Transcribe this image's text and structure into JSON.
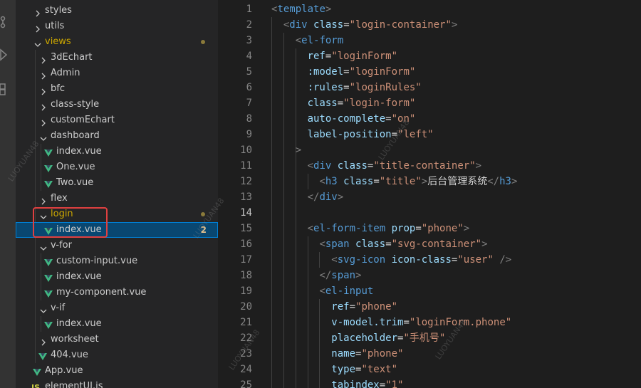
{
  "colors": {
    "selected_row": "#094771",
    "modified_label": "#cca700",
    "vue_green": "#41b883",
    "highlight_box": "#e04040"
  },
  "activity_bar": {
    "icons": [
      "source-control-icon",
      "run-debug-icon",
      "extensions-icon"
    ]
  },
  "explorer": {
    "items": [
      {
        "name": "styles",
        "type": "folder",
        "expanded": false,
        "depth": 1
      },
      {
        "name": "utils",
        "type": "folder",
        "expanded": false,
        "depth": 1
      },
      {
        "name": "views",
        "type": "folder",
        "expanded": true,
        "depth": 1,
        "modified": true
      },
      {
        "name": "3dEchart",
        "type": "folder",
        "expanded": false,
        "depth": 2
      },
      {
        "name": "Admin",
        "type": "folder",
        "expanded": false,
        "depth": 2
      },
      {
        "name": "bfc",
        "type": "folder",
        "expanded": false,
        "depth": 2
      },
      {
        "name": "class-style",
        "type": "folder",
        "expanded": false,
        "depth": 2
      },
      {
        "name": "customEchart",
        "type": "folder",
        "expanded": false,
        "depth": 2
      },
      {
        "name": "dashboard",
        "type": "folder",
        "expanded": true,
        "depth": 2
      },
      {
        "name": "index.vue",
        "type": "vue",
        "depth": 3
      },
      {
        "name": "One.vue",
        "type": "vue",
        "depth": 3
      },
      {
        "name": "Two.vue",
        "type": "vue",
        "depth": 3
      },
      {
        "name": "flex",
        "type": "folder",
        "expanded": false,
        "depth": 2
      },
      {
        "name": "login",
        "type": "folder",
        "expanded": true,
        "depth": 2,
        "modified": true
      },
      {
        "name": "index.vue",
        "type": "vue",
        "depth": 3,
        "selected": true,
        "badge": "2"
      },
      {
        "name": "v-for",
        "type": "folder",
        "expanded": true,
        "depth": 2
      },
      {
        "name": "custom-input.vue",
        "type": "vue",
        "depth": 3
      },
      {
        "name": "index.vue",
        "type": "vue",
        "depth": 3
      },
      {
        "name": "my-component.vue",
        "type": "vue",
        "depth": 3
      },
      {
        "name": "v-if",
        "type": "folder",
        "expanded": true,
        "depth": 2
      },
      {
        "name": "index.vue",
        "type": "vue",
        "depth": 3
      },
      {
        "name": "worksheet",
        "type": "folder",
        "expanded": false,
        "depth": 2
      },
      {
        "name": "404.vue",
        "type": "vue",
        "depth": 2
      },
      {
        "name": "App.vue",
        "type": "vue",
        "depth": 1
      },
      {
        "name": "elementUI.js",
        "type": "js",
        "depth": 1
      }
    ]
  },
  "editor": {
    "current_line": 14,
    "lines": [
      {
        "n": "1",
        "indent": 0,
        "tokens": [
          [
            "punct",
            "<"
          ],
          [
            "tag",
            "template"
          ],
          [
            "punct",
            ">"
          ]
        ]
      },
      {
        "n": "2",
        "indent": 1,
        "tokens": [
          [
            "punct",
            "<"
          ],
          [
            "tag",
            "div"
          ],
          [
            "text",
            " "
          ],
          [
            "attr",
            "class"
          ],
          [
            "text",
            "="
          ],
          [
            "str",
            "\"login-container\""
          ],
          [
            "punct",
            ">"
          ]
        ]
      },
      {
        "n": "3",
        "indent": 2,
        "tokens": [
          [
            "punct",
            "<"
          ],
          [
            "tag",
            "el-form"
          ]
        ]
      },
      {
        "n": "4",
        "indent": 3,
        "tokens": [
          [
            "attr",
            "ref"
          ],
          [
            "text",
            "="
          ],
          [
            "str",
            "\"loginForm\""
          ]
        ]
      },
      {
        "n": "5",
        "indent": 3,
        "tokens": [
          [
            "attr",
            ":model"
          ],
          [
            "text",
            "="
          ],
          [
            "str",
            "\"loginForm\""
          ]
        ]
      },
      {
        "n": "6",
        "indent": 3,
        "tokens": [
          [
            "attr",
            ":rules"
          ],
          [
            "text",
            "="
          ],
          [
            "str",
            "\"loginRules\""
          ]
        ]
      },
      {
        "n": "7",
        "indent": 3,
        "tokens": [
          [
            "attr",
            "class"
          ],
          [
            "text",
            "="
          ],
          [
            "str",
            "\"login-form\""
          ]
        ]
      },
      {
        "n": "8",
        "indent": 3,
        "tokens": [
          [
            "attr",
            "auto-complete"
          ],
          [
            "text",
            "="
          ],
          [
            "str",
            "\"on\""
          ]
        ]
      },
      {
        "n": "9",
        "indent": 3,
        "tokens": [
          [
            "attr",
            "label-position"
          ],
          [
            "text",
            "="
          ],
          [
            "str",
            "\"left\""
          ]
        ]
      },
      {
        "n": "10",
        "indent": 2,
        "tokens": [
          [
            "punct",
            ">"
          ]
        ]
      },
      {
        "n": "11",
        "indent": 3,
        "tokens": [
          [
            "punct",
            "<"
          ],
          [
            "tag",
            "div"
          ],
          [
            "text",
            " "
          ],
          [
            "attr",
            "class"
          ],
          [
            "text",
            "="
          ],
          [
            "str",
            "\"title-container\""
          ],
          [
            "punct",
            ">"
          ]
        ]
      },
      {
        "n": "12",
        "indent": 4,
        "tokens": [
          [
            "punct",
            "<"
          ],
          [
            "tag",
            "h3"
          ],
          [
            "text",
            " "
          ],
          [
            "attr",
            "class"
          ],
          [
            "text",
            "="
          ],
          [
            "str",
            "\"title\""
          ],
          [
            "punct",
            ">"
          ],
          [
            "text",
            "后台管理系统"
          ],
          [
            "punct",
            "</"
          ],
          [
            "tag",
            "h3"
          ],
          [
            "punct",
            ">"
          ]
        ]
      },
      {
        "n": "13",
        "indent": 3,
        "tokens": [
          [
            "punct",
            "</"
          ],
          [
            "tag",
            "div"
          ],
          [
            "punct",
            ">"
          ]
        ]
      },
      {
        "n": "14",
        "indent": 0,
        "tokens": []
      },
      {
        "n": "15",
        "indent": 3,
        "tokens": [
          [
            "punct",
            "<"
          ],
          [
            "tag",
            "el-form-item"
          ],
          [
            "text",
            " "
          ],
          [
            "attr",
            "prop"
          ],
          [
            "text",
            "="
          ],
          [
            "str",
            "\"phone\""
          ],
          [
            "punct",
            ">"
          ]
        ]
      },
      {
        "n": "16",
        "indent": 4,
        "tokens": [
          [
            "punct",
            "<"
          ],
          [
            "tag",
            "span"
          ],
          [
            "text",
            " "
          ],
          [
            "attr",
            "class"
          ],
          [
            "text",
            "="
          ],
          [
            "str",
            "\"svg-container\""
          ],
          [
            "punct",
            ">"
          ]
        ]
      },
      {
        "n": "17",
        "indent": 5,
        "tokens": [
          [
            "punct",
            "<"
          ],
          [
            "tag",
            "svg-icon"
          ],
          [
            "text",
            " "
          ],
          [
            "attr",
            "icon-class"
          ],
          [
            "text",
            "="
          ],
          [
            "str",
            "\"user\""
          ],
          [
            "text",
            " "
          ],
          [
            "punct",
            "/>"
          ]
        ]
      },
      {
        "n": "18",
        "indent": 4,
        "tokens": [
          [
            "punct",
            "</"
          ],
          [
            "tag",
            "span"
          ],
          [
            "punct",
            ">"
          ]
        ]
      },
      {
        "n": "19",
        "indent": 4,
        "tokens": [
          [
            "punct",
            "<"
          ],
          [
            "tag",
            "el-input"
          ]
        ]
      },
      {
        "n": "20",
        "indent": 5,
        "tokens": [
          [
            "attr",
            "ref"
          ],
          [
            "text",
            "="
          ],
          [
            "str",
            "\"phone\""
          ]
        ]
      },
      {
        "n": "21",
        "indent": 5,
        "tokens": [
          [
            "attr",
            "v-model.trim"
          ],
          [
            "text",
            "="
          ],
          [
            "str",
            "\"loginForm.phone\""
          ]
        ]
      },
      {
        "n": "22",
        "indent": 5,
        "tokens": [
          [
            "attr",
            "placeholder"
          ],
          [
            "text",
            "="
          ],
          [
            "str",
            "\"手机号\""
          ]
        ]
      },
      {
        "n": "23",
        "indent": 5,
        "tokens": [
          [
            "attr",
            "name"
          ],
          [
            "text",
            "="
          ],
          [
            "str",
            "\"phone\""
          ]
        ]
      },
      {
        "n": "24",
        "indent": 5,
        "tokens": [
          [
            "attr",
            "type"
          ],
          [
            "text",
            "="
          ],
          [
            "str",
            "\"text\""
          ]
        ]
      },
      {
        "n": "25",
        "indent": 5,
        "tokens": [
          [
            "attr",
            "tabindex"
          ],
          [
            "text",
            "="
          ],
          [
            "str",
            "\"1\""
          ]
        ]
      }
    ]
  },
  "watermark": {
    "text": "LUOYUAN48"
  }
}
